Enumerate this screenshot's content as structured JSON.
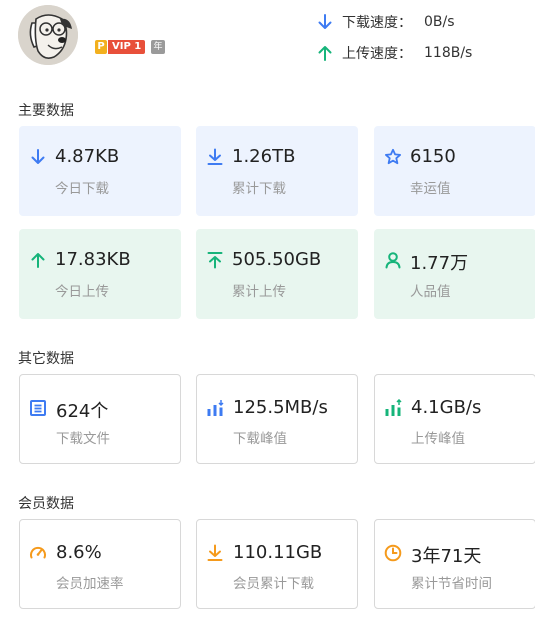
{
  "header": {
    "badges": {
      "p": "P",
      "vip": "VIP 1",
      "year": "年"
    },
    "download_speed": {
      "label": "下载速度：",
      "value": "0B/s"
    },
    "upload_speed": {
      "label": "上传速度：",
      "value": "118B/s"
    }
  },
  "sections": {
    "main": {
      "title": "主要数据",
      "cards": [
        {
          "value": "4.87KB",
          "label": "今日下载",
          "icon": "download-arrow-icon"
        },
        {
          "value": "1.26TB",
          "label": "累计下载",
          "icon": "download-to-line-icon"
        },
        {
          "value": "6150",
          "label": "幸运值",
          "icon": "star-icon"
        },
        {
          "value": "17.83KB",
          "label": "今日上传",
          "icon": "upload-arrow-icon"
        },
        {
          "value": "505.50GB",
          "label": "累计上传",
          "icon": "upload-from-line-icon"
        },
        {
          "value": "1.77万",
          "label": "人品值",
          "icon": "person-icon"
        }
      ]
    },
    "other": {
      "title": "其它数据",
      "cards": [
        {
          "value": "624个",
          "label": "下载文件",
          "icon": "file-list-icon"
        },
        {
          "value": "125.5MB/s",
          "label": "下载峰值",
          "icon": "download-peak-bars-icon"
        },
        {
          "value": "4.1GB/s",
          "label": "上传峰值",
          "icon": "upload-peak-bars-icon"
        }
      ]
    },
    "member": {
      "title": "会员数据",
      "cards": [
        {
          "value": "8.6%",
          "label": "会员加速率",
          "icon": "speedometer-icon"
        },
        {
          "value": "110.11GB",
          "label": "会员累计下载",
          "icon": "download-to-line-icon"
        },
        {
          "value": "3年71天",
          "label": "累计节省时间",
          "icon": "clock-icon"
        }
      ]
    }
  },
  "colors": {
    "blue": "#3e7bf2",
    "green": "#16b47a",
    "orange": "#f59a1c",
    "blue_card_bg": "#edf3fe",
    "green_card_bg": "#e8f6ef"
  }
}
